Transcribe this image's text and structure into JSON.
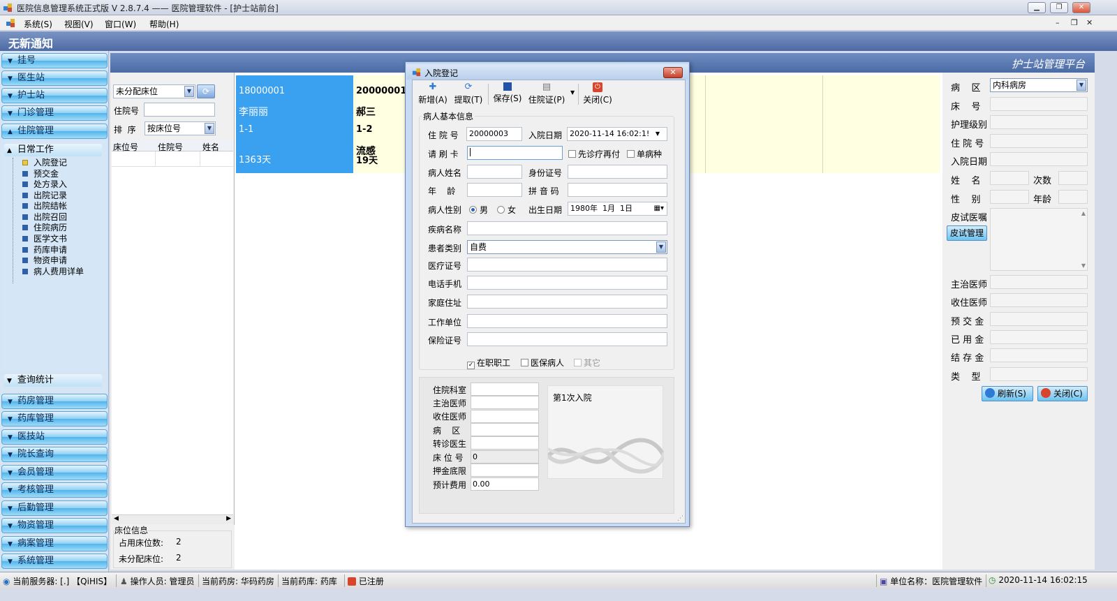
{
  "window": {
    "title": "医院信息管理系统正式版 V 2.8.7.4 —— 医院管理软件 - [护士站前台]",
    "controls": [
      "minimize",
      "restore",
      "close"
    ]
  },
  "menu": [
    "系统(S)",
    "视图(V)",
    "窗口(W)",
    "帮助(H)"
  ],
  "notice": "无新通知",
  "header_right_title": "护士站管理平台",
  "leftnav": {
    "top_buttons": [
      "挂号",
      "医生站",
      "护士站",
      "门诊管理",
      "住院管理"
    ],
    "tree_head": "日常工作",
    "tree_items": [
      "入院登记",
      "预交金",
      "处方录入",
      "出院记录",
      "出院结帐",
      "出院召回",
      "住院病历",
      "医学文书",
      "药库申请",
      "物资申请",
      "病人费用详单"
    ],
    "query_head": "查询统计",
    "bottom_buttons": [
      "药房管理",
      "药库管理",
      "医技站",
      "院长查询",
      "会员管理",
      "考核管理",
      "后勤管理",
      "物资管理",
      "病案管理",
      "系统管理"
    ]
  },
  "bedpanel": {
    "filter_value": "未分配床位",
    "inpatient_no_label": "住院号",
    "sort_label": "排  序",
    "sort_value": "按床位号",
    "grid_columns": [
      "床位号",
      "住院号",
      "姓名"
    ],
    "bed_info_title": "床位信息",
    "occupied_label": "占用床位数:",
    "occupied_value": "2",
    "unassigned_label": "未分配床位:",
    "unassigned_value": "2"
  },
  "cards": [
    {
      "id": "18000001",
      "name": "李丽丽",
      "bed": "1-1",
      "days": "1363天",
      "diag": ""
    },
    {
      "id": "20000001",
      "name": "郝三",
      "bed": "1-2",
      "days": "19天",
      "diag": "流感"
    }
  ],
  "dialog": {
    "title": "入院登记",
    "toolbar": [
      "新增(A)",
      "提取(T)",
      "保存(S)",
      "住院证(P)",
      "关闭(C)"
    ],
    "group_title": "病人基本信息",
    "inpatient_no_label": "住 院 号",
    "inpatient_no_value": "20000003",
    "admit_date_label": "入院日期",
    "admit_date_value": "2020-11-14 16:02:1!",
    "card_label": "请 刷 卡",
    "pre_treat_label": "先诊疗再付",
    "single_disease_label": "单病种",
    "name_label": "病人姓名",
    "id_label": "身份证号",
    "age_label": "年    龄",
    "pinyin_label": "拼 音 码",
    "gender_label": "病人性别",
    "male_label": "男",
    "female_label": "女",
    "birth_label": "出生日期",
    "birth_value": "1980年  1月  1日",
    "disease_label": "疾病名称",
    "patient_type_label": "患者类别",
    "patient_type_value": "自费",
    "medical_no_label": "医疗证号",
    "phone_label": "电话手机",
    "address_label": "家庭住址",
    "work_label": "工作单位",
    "insurance_label": "保险证号",
    "employed_label": "在职职工",
    "insured_label": "医保病人",
    "other_label": "其它",
    "lower_labels": [
      "住院科室",
      "主治医师",
      "收住医师",
      "病    区",
      "转诊医生",
      "床 位 号",
      "押金底限",
      "预计费用"
    ],
    "lower_values": [
      "",
      "",
      "",
      "",
      "",
      "0",
      "",
      "0.00"
    ],
    "visit_text": "第1次入院"
  },
  "rightpanel": {
    "ward_label": "病    区",
    "ward_value": "内科病房",
    "labels": [
      "床    号",
      "护理级别",
      "住 院 号",
      "入院日期"
    ],
    "name_label": "姓    名",
    "times_label": "次数",
    "sex_label": "性    别",
    "age_label": "年龄",
    "skin_test_label": "皮试医嘱",
    "skin_mgmt_button": "皮试管理",
    "labels2": [
      "主治医师",
      "收住医师",
      "预 交 金",
      "已 用 金",
      "结 存 金",
      "类    型"
    ],
    "refresh_button": "刷新(S)",
    "close_button": "关闭(C)"
  },
  "statusbar": {
    "server": "当前服务器: [.]  【QiHIS】",
    "operator": "操作人员: 管理员",
    "pharmacy": "当前药房: 华码药房",
    "warehouse": "当前药库: 药库",
    "registered": "已注册",
    "unit": "单位名称：医院管理软件",
    "datetime": "2020-11-14 16:02:15"
  },
  "colors": {
    "card_blue": "#3aa0f0",
    "card_yellow": "#ffffe1",
    "header_blue": "#4d6aa3"
  }
}
